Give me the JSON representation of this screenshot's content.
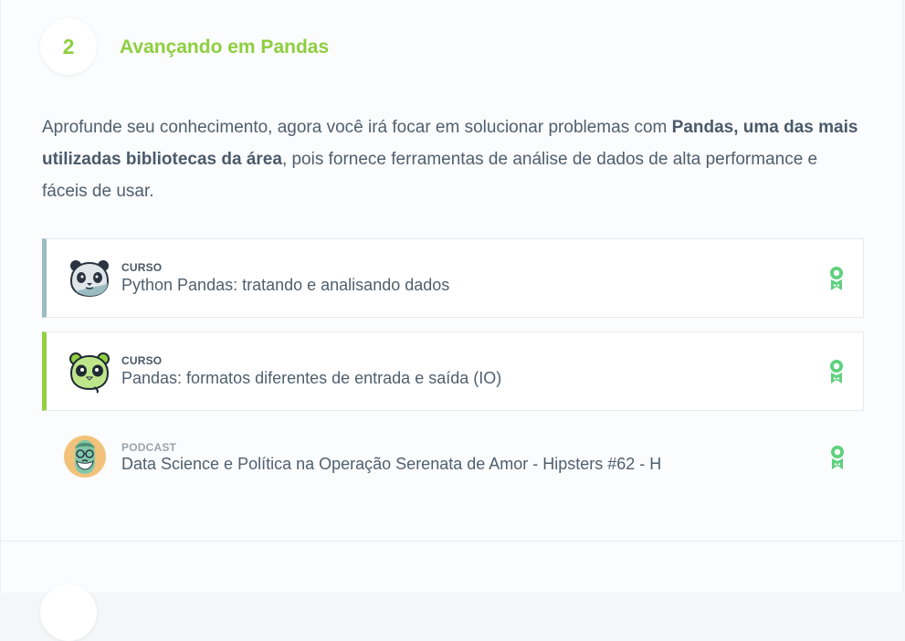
{
  "step": {
    "number": "2",
    "title": "Avançando em Pandas"
  },
  "description": {
    "part1": "Aprofunde seu conhecimento, agora você irá focar em solucionar problemas com ",
    "bold": "Pandas, uma das mais utilizadas bibliotecas da área",
    "part2": ", pois fornece ferramentas de análise de dados de alta performance e fáceis de usar."
  },
  "items": [
    {
      "kind": "CURSO",
      "title": "Python Pandas: tratando e analisando dados",
      "icon": "panda-icon",
      "accent": "#9bbcc3"
    },
    {
      "kind": "CURSO",
      "title": "Pandas: formatos diferentes de entrada e saída (IO)",
      "icon": "green-panda-icon",
      "accent": "#93d042"
    },
    {
      "kind": "PODCAST",
      "title": "Data Science e Política na Operação Serenata de Amor - Hipsters #62 - H",
      "icon": "hipster-avatar-icon"
    }
  ],
  "colors": {
    "accent_green": "#8dcf3f",
    "badge_green": "#5fd17f",
    "text": "#4f5f6e"
  }
}
